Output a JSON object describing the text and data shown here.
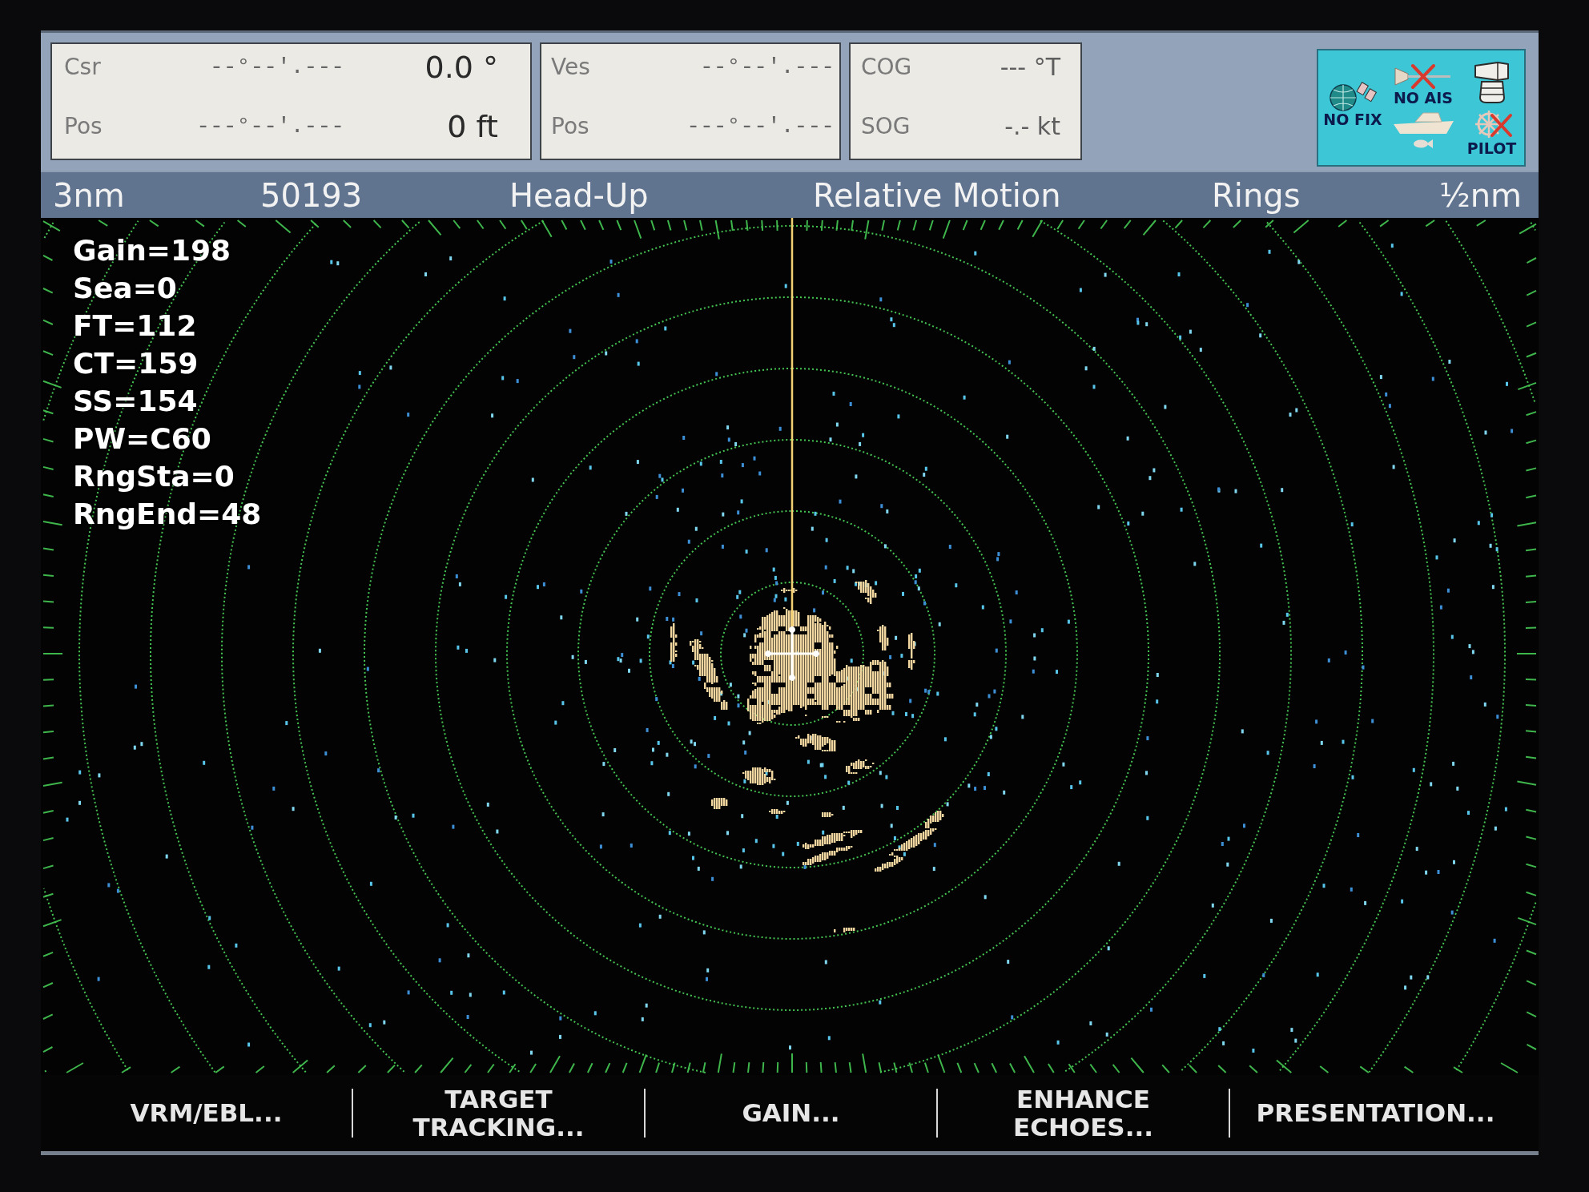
{
  "info_bar": {
    "panels": [
      {
        "kind": "cursor",
        "rows": [
          {
            "label": "Csr",
            "position": "--°--'.---",
            "value": "0.0 °"
          },
          {
            "label": "Pos",
            "position": "---°--'.---",
            "value": "0 ft"
          }
        ]
      },
      {
        "kind": "vessel",
        "rows": [
          {
            "label": "Ves",
            "position": "--°--'.---"
          },
          {
            "label": "Pos",
            "position": "---°--'.---"
          }
        ]
      },
      {
        "kind": "motion",
        "rows": [
          {
            "label": "COG",
            "value": "--- °T"
          },
          {
            "label": "SOG",
            "value": "-.- kt"
          }
        ]
      }
    ],
    "status_panel": {
      "columns": [
        [
          {
            "kind": "gps",
            "label": "NO FIX",
            "crossed": false
          }
        ],
        [
          {
            "kind": "ais",
            "label": "NO AIS",
            "crossed": true
          },
          {
            "kind": "boat",
            "crossed": false
          },
          {
            "kind": "fish",
            "crossed": false
          }
        ],
        [
          {
            "kind": "radar",
            "crossed": false
          },
          {
            "kind": "autopilot",
            "label": "PILOT",
            "crossed": true
          }
        ]
      ]
    }
  },
  "status_bar": {
    "items": [
      "3nm",
      "50193",
      "Head-Up",
      "Relative Motion",
      "Rings",
      "½nm"
    ]
  },
  "radar": {
    "readouts": [
      "Gain=198",
      "Sea=0",
      "FT=112",
      "CT=159",
      "SS=154",
      "PW=C60",
      "RngSta=0",
      "RngEnd=48"
    ]
  },
  "soft_keys": [
    "VRM/EBL...",
    "TARGET TRACKING...",
    "GAIN...",
    "ENHANCE ECHOES...",
    "PRESENTATION..."
  ]
}
